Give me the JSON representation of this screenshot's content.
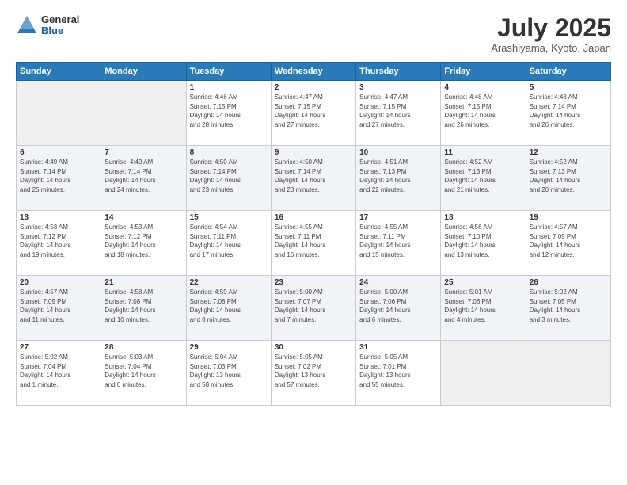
{
  "header": {
    "logo_general": "General",
    "logo_blue": "Blue",
    "month_year": "July 2025",
    "location": "Arashiyama, Kyoto, Japan"
  },
  "weekdays": [
    "Sunday",
    "Monday",
    "Tuesday",
    "Wednesday",
    "Thursday",
    "Friday",
    "Saturday"
  ],
  "weeks": [
    [
      {
        "day": "",
        "info": ""
      },
      {
        "day": "",
        "info": ""
      },
      {
        "day": "1",
        "info": "Sunrise: 4:46 AM\nSunset: 7:15 PM\nDaylight: 14 hours\nand 28 minutes."
      },
      {
        "day": "2",
        "info": "Sunrise: 4:47 AM\nSunset: 7:15 PM\nDaylight: 14 hours\nand 27 minutes."
      },
      {
        "day": "3",
        "info": "Sunrise: 4:47 AM\nSunset: 7:15 PM\nDaylight: 14 hours\nand 27 minutes."
      },
      {
        "day": "4",
        "info": "Sunrise: 4:48 AM\nSunset: 7:15 PM\nDaylight: 14 hours\nand 26 minutes."
      },
      {
        "day": "5",
        "info": "Sunrise: 4:48 AM\nSunset: 7:14 PM\nDaylight: 14 hours\nand 26 minutes."
      }
    ],
    [
      {
        "day": "6",
        "info": "Sunrise: 4:49 AM\nSunset: 7:14 PM\nDaylight: 14 hours\nand 25 minutes."
      },
      {
        "day": "7",
        "info": "Sunrise: 4:49 AM\nSunset: 7:14 PM\nDaylight: 14 hours\nand 24 minutes."
      },
      {
        "day": "8",
        "info": "Sunrise: 4:50 AM\nSunset: 7:14 PM\nDaylight: 14 hours\nand 23 minutes."
      },
      {
        "day": "9",
        "info": "Sunrise: 4:50 AM\nSunset: 7:14 PM\nDaylight: 14 hours\nand 23 minutes."
      },
      {
        "day": "10",
        "info": "Sunrise: 4:51 AM\nSunset: 7:13 PM\nDaylight: 14 hours\nand 22 minutes."
      },
      {
        "day": "11",
        "info": "Sunrise: 4:52 AM\nSunset: 7:13 PM\nDaylight: 14 hours\nand 21 minutes."
      },
      {
        "day": "12",
        "info": "Sunrise: 4:52 AM\nSunset: 7:13 PM\nDaylight: 14 hours\nand 20 minutes."
      }
    ],
    [
      {
        "day": "13",
        "info": "Sunrise: 4:53 AM\nSunset: 7:12 PM\nDaylight: 14 hours\nand 19 minutes."
      },
      {
        "day": "14",
        "info": "Sunrise: 4:53 AM\nSunset: 7:12 PM\nDaylight: 14 hours\nand 18 minutes."
      },
      {
        "day": "15",
        "info": "Sunrise: 4:54 AM\nSunset: 7:11 PM\nDaylight: 14 hours\nand 17 minutes."
      },
      {
        "day": "16",
        "info": "Sunrise: 4:55 AM\nSunset: 7:11 PM\nDaylight: 14 hours\nand 16 minutes."
      },
      {
        "day": "17",
        "info": "Sunrise: 4:55 AM\nSunset: 7:11 PM\nDaylight: 14 hours\nand 15 minutes."
      },
      {
        "day": "18",
        "info": "Sunrise: 4:56 AM\nSunset: 7:10 PM\nDaylight: 14 hours\nand 13 minutes."
      },
      {
        "day": "19",
        "info": "Sunrise: 4:57 AM\nSunset: 7:09 PM\nDaylight: 14 hours\nand 12 minutes."
      }
    ],
    [
      {
        "day": "20",
        "info": "Sunrise: 4:57 AM\nSunset: 7:09 PM\nDaylight: 14 hours\nand 11 minutes."
      },
      {
        "day": "21",
        "info": "Sunrise: 4:58 AM\nSunset: 7:08 PM\nDaylight: 14 hours\nand 10 minutes."
      },
      {
        "day": "22",
        "info": "Sunrise: 4:59 AM\nSunset: 7:08 PM\nDaylight: 14 hours\nand 8 minutes."
      },
      {
        "day": "23",
        "info": "Sunrise: 5:00 AM\nSunset: 7:07 PM\nDaylight: 14 hours\nand 7 minutes."
      },
      {
        "day": "24",
        "info": "Sunrise: 5:00 AM\nSunset: 7:06 PM\nDaylight: 14 hours\nand 6 minutes."
      },
      {
        "day": "25",
        "info": "Sunrise: 5:01 AM\nSunset: 7:06 PM\nDaylight: 14 hours\nand 4 minutes."
      },
      {
        "day": "26",
        "info": "Sunrise: 5:02 AM\nSunset: 7:05 PM\nDaylight: 14 hours\nand 3 minutes."
      }
    ],
    [
      {
        "day": "27",
        "info": "Sunrise: 5:02 AM\nSunset: 7:04 PM\nDaylight: 14 hours\nand 1 minute."
      },
      {
        "day": "28",
        "info": "Sunrise: 5:03 AM\nSunset: 7:04 PM\nDaylight: 14 hours\nand 0 minutes."
      },
      {
        "day": "29",
        "info": "Sunrise: 5:04 AM\nSunset: 7:03 PM\nDaylight: 13 hours\nand 58 minutes."
      },
      {
        "day": "30",
        "info": "Sunrise: 5:05 AM\nSunset: 7:02 PM\nDaylight: 13 hours\nand 57 minutes."
      },
      {
        "day": "31",
        "info": "Sunrise: 5:05 AM\nSunset: 7:01 PM\nDaylight: 13 hours\nand 55 minutes."
      },
      {
        "day": "",
        "info": ""
      },
      {
        "day": "",
        "info": ""
      }
    ]
  ]
}
